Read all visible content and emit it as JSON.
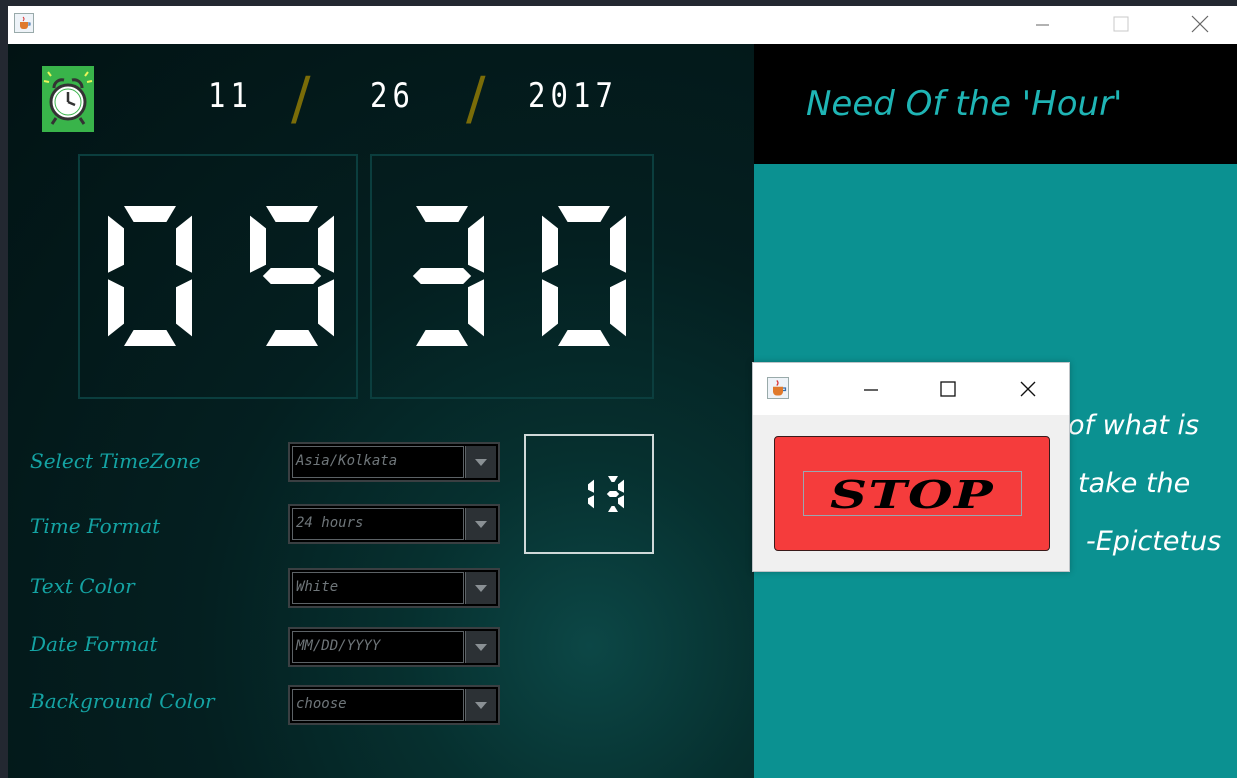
{
  "window": {
    "icon": "java-cup-icon",
    "controls": [
      "minimize-icon",
      "maximize-icon",
      "close-icon"
    ]
  },
  "date": {
    "month": "11",
    "day": "26",
    "year": "2017",
    "separator": "/"
  },
  "clock": {
    "hour_tens": "0",
    "hour_ones": "9",
    "minute_tens": "3",
    "minute_ones": "0",
    "seconds": "13"
  },
  "settings": [
    {
      "label": "Select TimeZone",
      "value": "Asia/Kolkata"
    },
    {
      "label": "Time Format",
      "value": "24 hours"
    },
    {
      "label": "Text Color",
      "value": "White"
    },
    {
      "label": "Date Format",
      "value": "MM/DD/YYYY"
    },
    {
      "label": "Background Color",
      "value": "choose"
    }
  ],
  "quote_panel": {
    "title": "Need Of the 'Hour'",
    "lines": [
      "of what is",
      "take the",
      "-Epictetus"
    ]
  },
  "popup": {
    "icon": "java-cup-icon",
    "button_label": "STOP"
  },
  "colors": {
    "accent_teal": "#14a3a3",
    "quote_bg": "#0b9191",
    "stop_red": "#f53c3c",
    "slash_olive": "#7a6c08"
  }
}
